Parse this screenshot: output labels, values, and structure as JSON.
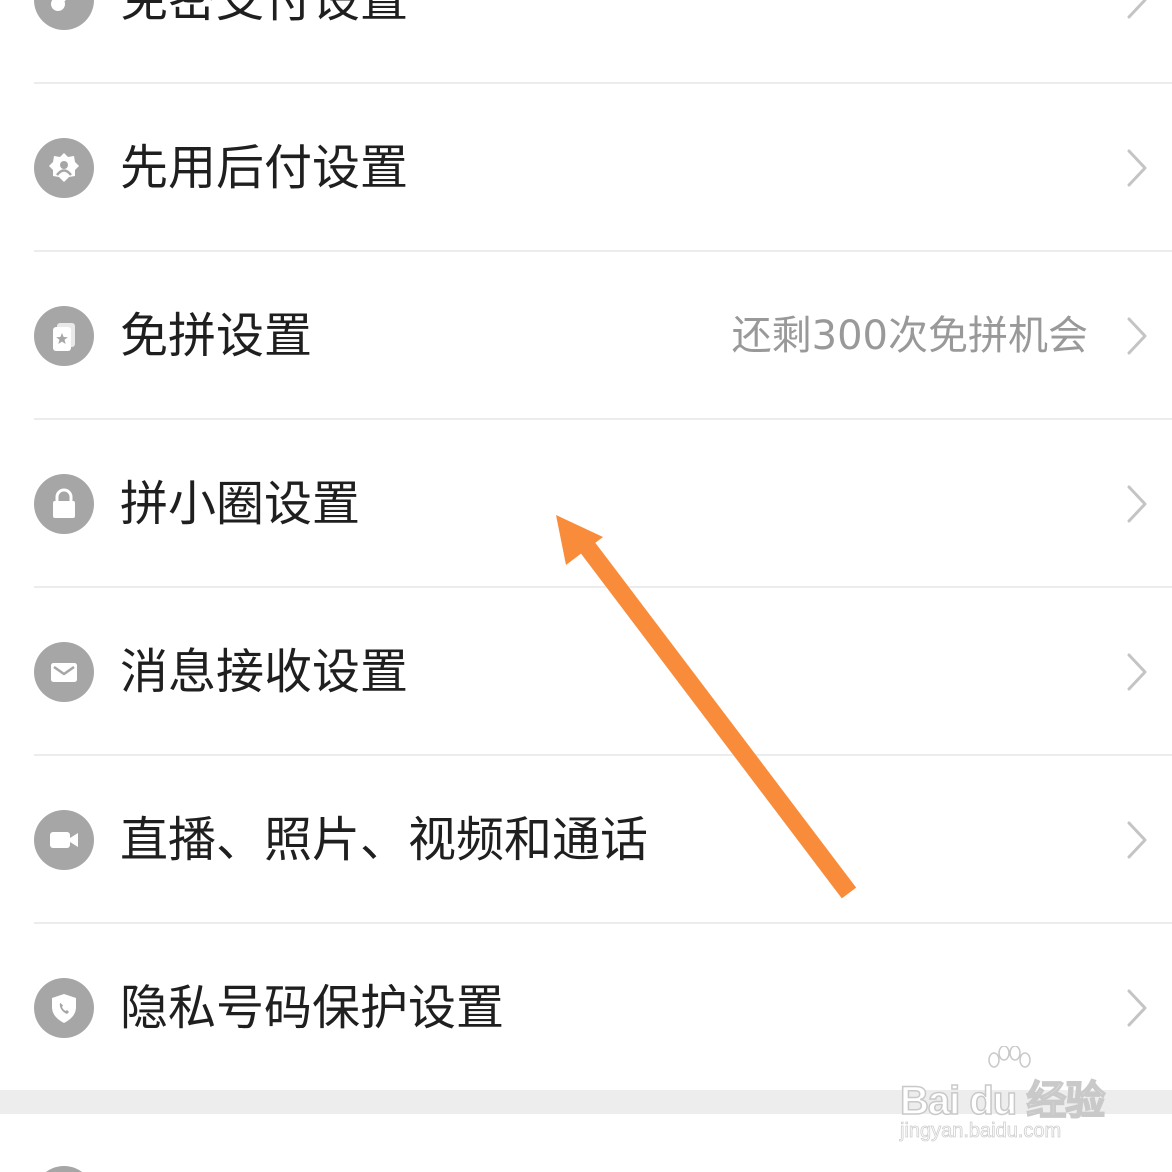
{
  "settings": {
    "items": [
      {
        "label": "免密支付设置",
        "value": "",
        "icon": "key-icon"
      },
      {
        "label": "先用后付设置",
        "value": "",
        "icon": "badge-icon"
      },
      {
        "label": "免拼设置",
        "value": "还剩300次免拼机会",
        "icon": "star-card-icon"
      },
      {
        "label": "拼小圈设置",
        "value": "",
        "icon": "lock-icon"
      },
      {
        "label": "消息接收设置",
        "value": "",
        "icon": "mail-icon"
      },
      {
        "label": "直播、照片、视频和通话",
        "value": "",
        "icon": "video-camera-icon"
      },
      {
        "label": "隐私号码保护设置",
        "value": "",
        "icon": "shield-phone-icon"
      }
    ]
  },
  "annotation": {
    "arrow_color": "#f98c3a",
    "points_to": "拼小圈设置"
  },
  "watermark": {
    "brand": "Bai du 经验",
    "url": "jingyan.baidu.com"
  },
  "colors": {
    "icon_bg": "#a6a6a6",
    "label_text": "#1f1f1f",
    "value_text": "#999999",
    "divider": "#ececec",
    "section_gap": "#ededed"
  }
}
